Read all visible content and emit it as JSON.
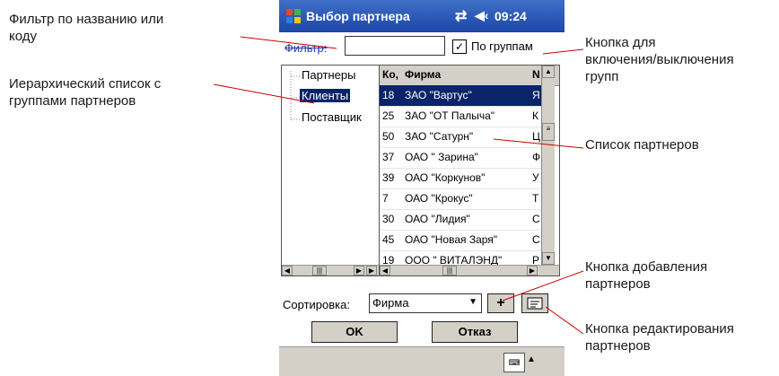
{
  "annotations": {
    "filter_note": "Фильтр по названию или\nкоду",
    "tree_note": "Иерархический список с\nгруппами партнеров",
    "group_toggle_note": "Кнопка для\nвключения/выключения\nгрупп",
    "list_note": "Список партнеров",
    "add_note": "Кнопка добавления\nпартнеров",
    "edit_note": "Кнопка редактирования\nпартнеров"
  },
  "window": {
    "title": "Выбор партнера",
    "time": "09:24",
    "connection_icon": "connection-icon",
    "volume_icon": "volume-icon"
  },
  "filter": {
    "label": "Фильтр:",
    "value": "",
    "groups_checkbox_label": "По группам",
    "groups_checked": true,
    "check_mark": "✓"
  },
  "tree": {
    "items": [
      {
        "label": "Партнеры",
        "selected": false
      },
      {
        "label": "Клиенты",
        "selected": true
      },
      {
        "label": "Поставщик",
        "selected": false
      }
    ]
  },
  "grid": {
    "columns": [
      "Ко,",
      "Фирма",
      "N"
    ],
    "rows": [
      {
        "code": "18",
        "firm": "ЗАО \"Вартус\"",
        "extra": "Я",
        "selected": true
      },
      {
        "code": "25",
        "firm": "ЗАО \"ОТ Палыча\"",
        "extra": "К",
        "selected": false
      },
      {
        "code": "50",
        "firm": "ЗАО \"Сатурн\"",
        "extra": "Ц",
        "selected": false
      },
      {
        "code": "37",
        "firm": "ОАО \" Зарина\"",
        "extra": "Ф",
        "selected": false
      },
      {
        "code": "39",
        "firm": "ОАО \"Коркунов\"",
        "extra": "У",
        "selected": false
      },
      {
        "code": "7",
        "firm": "ОАО \"Крокус\"",
        "extra": "Т",
        "selected": false
      },
      {
        "code": "30",
        "firm": "ОАО \"Лидия\"",
        "extra": "С",
        "selected": false
      },
      {
        "code": "45",
        "firm": "ОАО \"Новая Заря\"",
        "extra": "С",
        "selected": false
      },
      {
        "code": "19",
        "firm": "ООО \" ВИТАЛЭНД\"",
        "extra": "Р",
        "selected": false
      }
    ]
  },
  "sort": {
    "label": "Сортировка:",
    "value": "Фирма"
  },
  "buttons": {
    "add": "+",
    "ok": "OK",
    "cancel": "Отказ"
  },
  "colors": {
    "title_bar": "#1c46a8",
    "selection": "#0a246a",
    "chrome": "#d4d0c8"
  }
}
